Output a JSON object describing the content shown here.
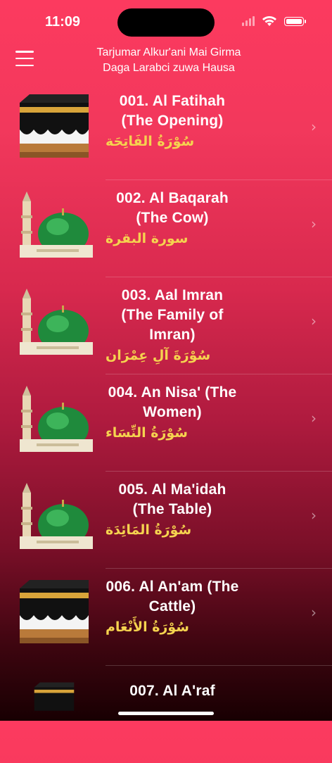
{
  "status": {
    "time": "11:09"
  },
  "nav": {
    "title_line1": "Tarjumar Alkur'ani Mai Girma",
    "title_line2": "Daga Larabci zuwa Hausa"
  },
  "colors": {
    "accent": "#f5d34f",
    "background_top": "#fc3a5f",
    "background_bottom": "#180002"
  },
  "surahs": [
    {
      "title": "001. Al Fatihah (The Opening)",
      "arabic": "سُوْرَةُ الفَاتِحَة",
      "icon": "kaaba-icon"
    },
    {
      "title": "002. Al Baqarah (The Cow)",
      "arabic": "سورة البقرة",
      "icon": "mosque-dome-icon"
    },
    {
      "title": "003. Aal Imran (The Family of Imran)",
      "arabic": "سُوْرَةَ آلِ عِمْرَان",
      "icon": "mosque-dome-icon"
    },
    {
      "title": "004. An Nisa' (The Women)",
      "arabic": "سُوْرَةُ النِّسَاء",
      "icon": "mosque-dome-icon"
    },
    {
      "title": "005. Al Ma'idah (The Table)",
      "arabic": "سُوْرَةُ المَائِدَة",
      "icon": "mosque-dome-icon"
    },
    {
      "title": "006. Al An'am (The Cattle)",
      "arabic": "سُوْرَةُ الأَنْعَام",
      "icon": "kaaba-icon"
    },
    {
      "title": "007. Al A'raf",
      "arabic": "",
      "icon": "kaaba-icon"
    }
  ]
}
